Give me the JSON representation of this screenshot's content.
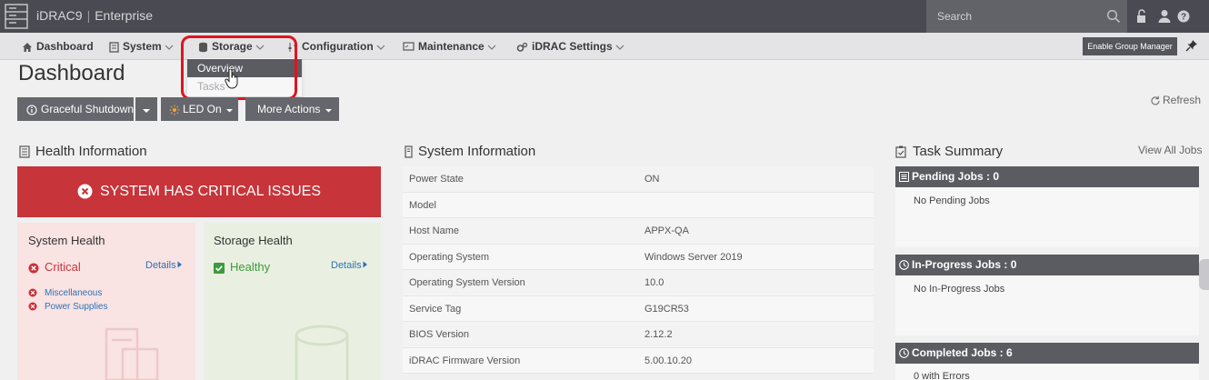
{
  "header": {
    "brand": "iDRAC9",
    "edition": "Enterprise",
    "search_placeholder": "Search"
  },
  "nav": {
    "dashboard": "Dashboard",
    "system": "System",
    "storage": "Storage",
    "configuration": "Configuration",
    "maintenance": "Maintenance",
    "idrac_settings": "iDRAC Settings",
    "group_manager_button": "Enable Group Manager"
  },
  "storage_menu": {
    "items": [
      "Overview",
      "Tasks"
    ],
    "hovered": "Overview"
  },
  "page": {
    "title": "Dashboard"
  },
  "actions": {
    "graceful_shutdown": "Graceful Shutdown",
    "led_on": "LED On",
    "more_actions": "More Actions",
    "refresh": "Refresh"
  },
  "health": {
    "title": "Health Information",
    "banner": "SYSTEM HAS CRITICAL ISSUES",
    "system": {
      "title": "System Health",
      "status": "Critical",
      "details": "Details",
      "issues": [
        "Miscellaneous",
        "Power Supplies"
      ]
    },
    "storage": {
      "title": "Storage Health",
      "status": "Healthy",
      "details": "Details"
    }
  },
  "system_info": {
    "title": "System Information",
    "rows": [
      {
        "label": "Power State",
        "value": "ON"
      },
      {
        "label": "Model",
        "value": ""
      },
      {
        "label": "Host Name",
        "value": "APPX-QA"
      },
      {
        "label": "Operating System",
        "value": "Windows Server 2019"
      },
      {
        "label": "Operating System Version",
        "value": "10.0"
      },
      {
        "label": "Service Tag",
        "value": "G19CR53"
      },
      {
        "label": "BIOS Version",
        "value": "2.12.2"
      },
      {
        "label": "iDRAC Firmware Version",
        "value": "5.00.10.20"
      }
    ]
  },
  "tasks": {
    "title": "Task Summary",
    "view_all": "View All Jobs",
    "pending": {
      "heading": "Pending Jobs : 0",
      "body": "No Pending Jobs"
    },
    "in_progress": {
      "heading": "In-Progress Jobs : 0",
      "body": "No In-Progress Jobs"
    },
    "completed": {
      "heading": "Completed Jobs : 6",
      "body": "0  with Errors"
    }
  },
  "colors": {
    "topbar": "#4a4a52",
    "critical": "#c7343a",
    "healthy": "#3d9a3d",
    "link": "#2e72b8",
    "highlight": "#e0141e"
  }
}
